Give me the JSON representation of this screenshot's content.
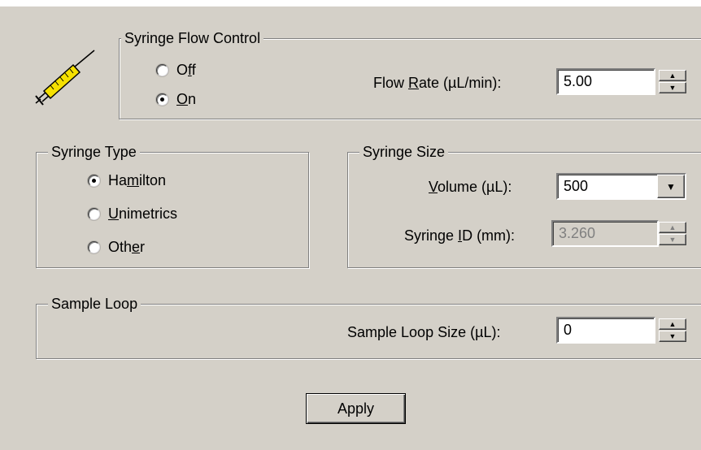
{
  "syringe_flow_control": {
    "legend": "Syringe Flow Control",
    "off_label": "Off",
    "on_label": "On",
    "selected": "On",
    "flow_rate_label": "Flow Rate (µL/min):",
    "flow_rate_value": "5.00"
  },
  "syringe_type": {
    "legend": "Syringe Type",
    "options": [
      "Hamilton",
      "Unimetrics",
      "Other"
    ],
    "selected": "Hamilton"
  },
  "syringe_size": {
    "legend": "Syringe Size",
    "volume_label": "Volume (µL):",
    "volume_value": "500",
    "syringe_id_label": "Syringe ID (mm):",
    "syringe_id_value": "3.260"
  },
  "sample_loop": {
    "legend": "Sample Loop",
    "size_label": "Sample Loop Size (µL):",
    "size_value": "0"
  },
  "apply_label": "Apply",
  "icons": [
    "syringe-icon",
    "spin-up-arrow",
    "spin-down-arrow",
    "dropdown-arrow"
  ]
}
